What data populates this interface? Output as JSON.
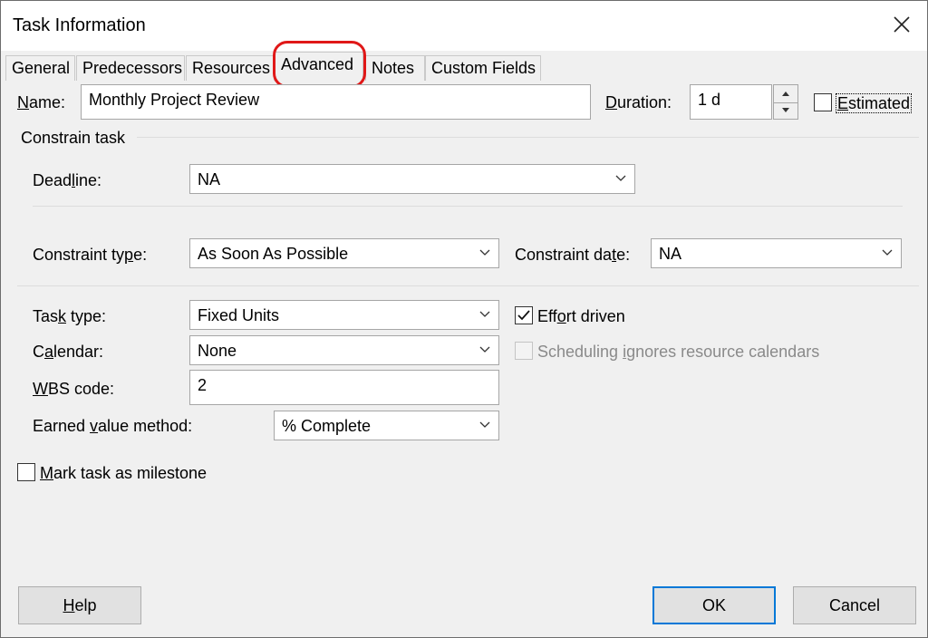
{
  "window": {
    "title": "Task Information"
  },
  "tabs": [
    {
      "label": "General"
    },
    {
      "label": "Predecessors"
    },
    {
      "label": "Resources"
    },
    {
      "label": "Advanced"
    },
    {
      "label": "Notes"
    },
    {
      "label": "Custom Fields"
    }
  ],
  "name": {
    "label_u": "N",
    "label_rest": "ame:",
    "value": "Monthly Project Review"
  },
  "duration": {
    "label_u": "D",
    "label_rest": "uration:",
    "value": "1 d"
  },
  "estimated": {
    "label_u": "E",
    "label_rest": "stimated",
    "checked": false
  },
  "constrain_section": {
    "label": "Constrain task"
  },
  "deadline": {
    "label_pre": "Dead",
    "label_u": "l",
    "label_rest": "ine:",
    "value": "NA"
  },
  "constraint_type": {
    "label_pre": "Constraint ty",
    "label_u": "p",
    "label_rest": "e:",
    "value": "As Soon As Possible"
  },
  "constraint_date": {
    "label_pre": "Constraint da",
    "label_u": "t",
    "label_rest": "e:",
    "value": "NA"
  },
  "task_type": {
    "label_pre": "Tas",
    "label_u": "k",
    "label_rest": " type:",
    "value": "Fixed Units"
  },
  "effort_driven": {
    "label_pre": "Eff",
    "label_u": "o",
    "label_rest": "rt driven",
    "checked": true
  },
  "calendar": {
    "label_pre": "C",
    "label_u": "a",
    "label_rest": "lendar:",
    "value": "None"
  },
  "scheduling_ignores": {
    "label_pre": "Scheduling ",
    "label_u": "i",
    "label_rest": "gnores resource calendars",
    "checked": false,
    "disabled": true
  },
  "wbs": {
    "label_u": "W",
    "label_rest": "BS code:",
    "value": "2"
  },
  "earned_value": {
    "label_pre": "Earned ",
    "label_u": "v",
    "label_rest": "alue method:",
    "value": "% Complete"
  },
  "milestone": {
    "label_u": "M",
    "label_rest": "ark task as milestone",
    "checked": false
  },
  "buttons": {
    "help_u": "H",
    "help_rest": "elp",
    "ok": "OK",
    "cancel": "Cancel"
  },
  "annotation": {
    "highlight_color": "#e01818",
    "highlighted_tab": "Advanced"
  }
}
